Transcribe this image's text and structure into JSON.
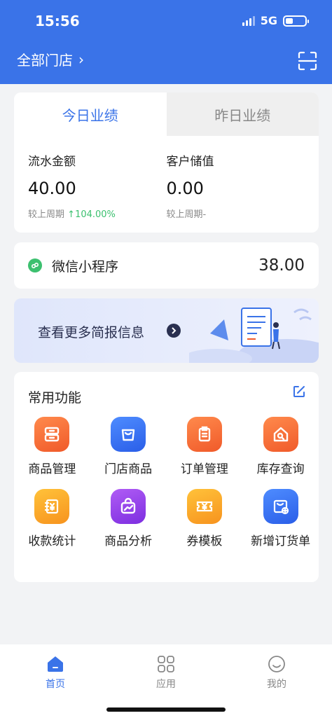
{
  "status": {
    "time": "15:56",
    "network": "5G"
  },
  "header": {
    "store": "全部门店",
    "store_chevron": "›"
  },
  "performance": {
    "tabs": [
      {
        "label": "今日业绩"
      },
      {
        "label": "昨日业绩"
      }
    ],
    "metrics": [
      {
        "label": "流水金额",
        "value": "40.00",
        "compare_label": "较上周期",
        "compare_value": "104.00%",
        "arrow": "↑"
      },
      {
        "label": "客户储值",
        "value": "0.00",
        "compare_label": "较上周期",
        "compare_value": "-"
      }
    ]
  },
  "channel": {
    "name": "微信小程序",
    "amount": "38.00"
  },
  "banner": {
    "text": "查看更多简报信息"
  },
  "functions": {
    "title": "常用功能",
    "items": [
      {
        "label": "商品管理",
        "icon": "drawer-icon",
        "color": "#f26b3a"
      },
      {
        "label": "门店商品",
        "icon": "shopping-bag-icon",
        "color": "#3a6ef0"
      },
      {
        "label": "订单管理",
        "icon": "clipboard-icon",
        "color": "#f26b3a"
      },
      {
        "label": "库存查询",
        "icon": "house-search-icon",
        "color": "#f26b3a"
      },
      {
        "label": "收款统计",
        "icon": "yen-book-icon",
        "color": "#f8a52a"
      },
      {
        "label": "商品分析",
        "icon": "chart-bag-icon",
        "color": "#9a45ea"
      },
      {
        "label": "券模板",
        "icon": "yen-ticket-icon",
        "color": "#f8a52a"
      },
      {
        "label": "新增订货单",
        "icon": "cart-add-icon",
        "color": "#3a6ef0"
      }
    ]
  },
  "tabbar": {
    "items": [
      {
        "label": "首页"
      },
      {
        "label": "应用"
      },
      {
        "label": "我的"
      }
    ]
  }
}
